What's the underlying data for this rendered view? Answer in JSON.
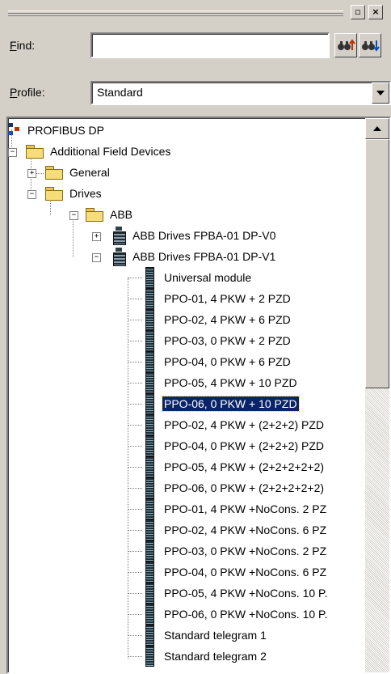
{
  "window": {
    "minimize_glyph": "▫",
    "close_glyph": "×"
  },
  "find": {
    "label_accel": "F",
    "label_rest": "ind:",
    "value": "",
    "placeholder": ""
  },
  "profile": {
    "label_accel": "P",
    "label_rest": "rofile:",
    "selected": "Standard"
  },
  "tree": {
    "root": "PROFIBUS DP",
    "additional": "Additional Field Devices",
    "general": "General",
    "drives": "Drives",
    "abb": "ABB",
    "device_v0": "ABB Drives FPBA-01 DP-V0",
    "device_v1": "ABB Drives FPBA-01 DP-V1",
    "modules": [
      "Universal module",
      "PPO-01, 4 PKW + 2 PZD",
      "PPO-02, 4 PKW + 6 PZD",
      "PPO-03, 0 PKW + 2 PZD",
      "PPO-04, 0 PKW + 6 PZD",
      "PPO-05, 4 PKW + 10 PZD",
      "PPO-06, 0 PKW + 10 PZD",
      "PPO-02, 4 PKW + (2+2+2) PZD",
      "PPO-04, 0 PKW + (2+2+2) PZD",
      "PPO-05, 4 PKW + (2+2+2+2+2)",
      "PPO-06, 0 PKW + (2+2+2+2+2)",
      "PPO-01, 4 PKW +NoCons. 2 PZ",
      "PPO-02, 4 PKW +NoCons. 6 PZ",
      "PPO-03, 0 PKW +NoCons. 2 PZ",
      "PPO-04, 0 PKW +NoCons. 6 PZ",
      "PPO-05, 4 PKW +NoCons. 10 P.",
      "PPO-06, 0 PKW +NoCons. 10 P.",
      "Standard telegram 1",
      "Standard telegram 2"
    ],
    "selected_index": 6
  },
  "colors": {
    "selection": "#0a246a",
    "face": "#d4d0c8"
  }
}
